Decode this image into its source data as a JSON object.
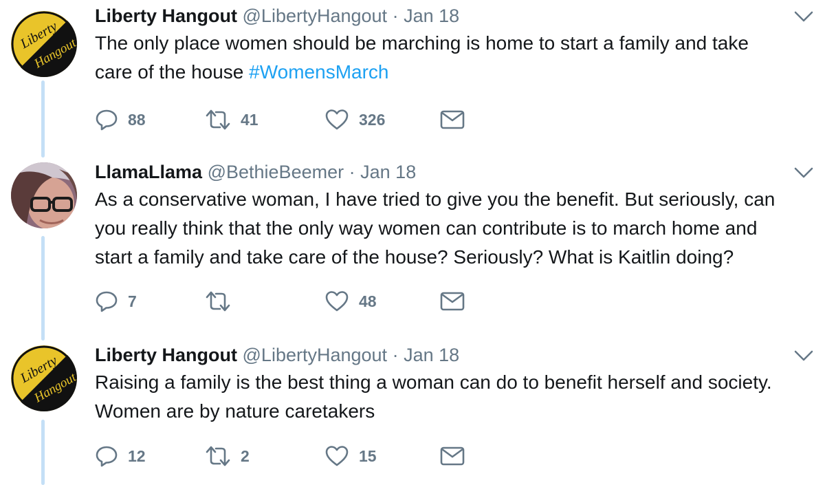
{
  "tweets": [
    {
      "name": "Liberty Hangout",
      "handle": "@LibertyHangout",
      "separator": "·",
      "date": "Jan 18",
      "text_lines": [
        "The only place women should be marching is home to start a family and take",
        "care of the house "
      ],
      "hashtag": "#WomensMarch",
      "replies": "88",
      "retweets": "41",
      "likes": "326",
      "avatar_lettering": [
        "Liberty",
        "Hangout"
      ]
    },
    {
      "name": "LlamaLlama",
      "handle": "@BethieBeemer",
      "separator": "·",
      "date": "Jan 18",
      "text_lines": [
        "As a conservative woman, I have tried to give you the benefit.  But seriously, can",
        "you really think that the only way women can contribute is to march home and",
        "start a family and take care of the house?  Seriously? What is Kaitlin doing?"
      ],
      "replies": "7",
      "retweets": "",
      "likes": "48"
    },
    {
      "name": "Liberty Hangout",
      "handle": "@LibertyHangout",
      "separator": "·",
      "date": "Jan 18",
      "text_lines": [
        "Raising a family is the best thing a woman can do to benefit herself and society.",
        "Women are by nature caretakers"
      ],
      "replies": "12",
      "retweets": "2",
      "likes": "15",
      "avatar_lettering": [
        "Liberty",
        "Hangout"
      ]
    }
  ],
  "colors": {
    "name": "#14171a",
    "secondary": "#657786",
    "hashtag": "#1da1f2",
    "thread_line": "#c4dff6",
    "avatar_gold": "#e9c42a",
    "avatar_black": "#111111"
  },
  "icons": [
    "reply-icon",
    "retweet-icon",
    "like-icon",
    "direct-message-icon",
    "chevron-down-icon"
  ]
}
